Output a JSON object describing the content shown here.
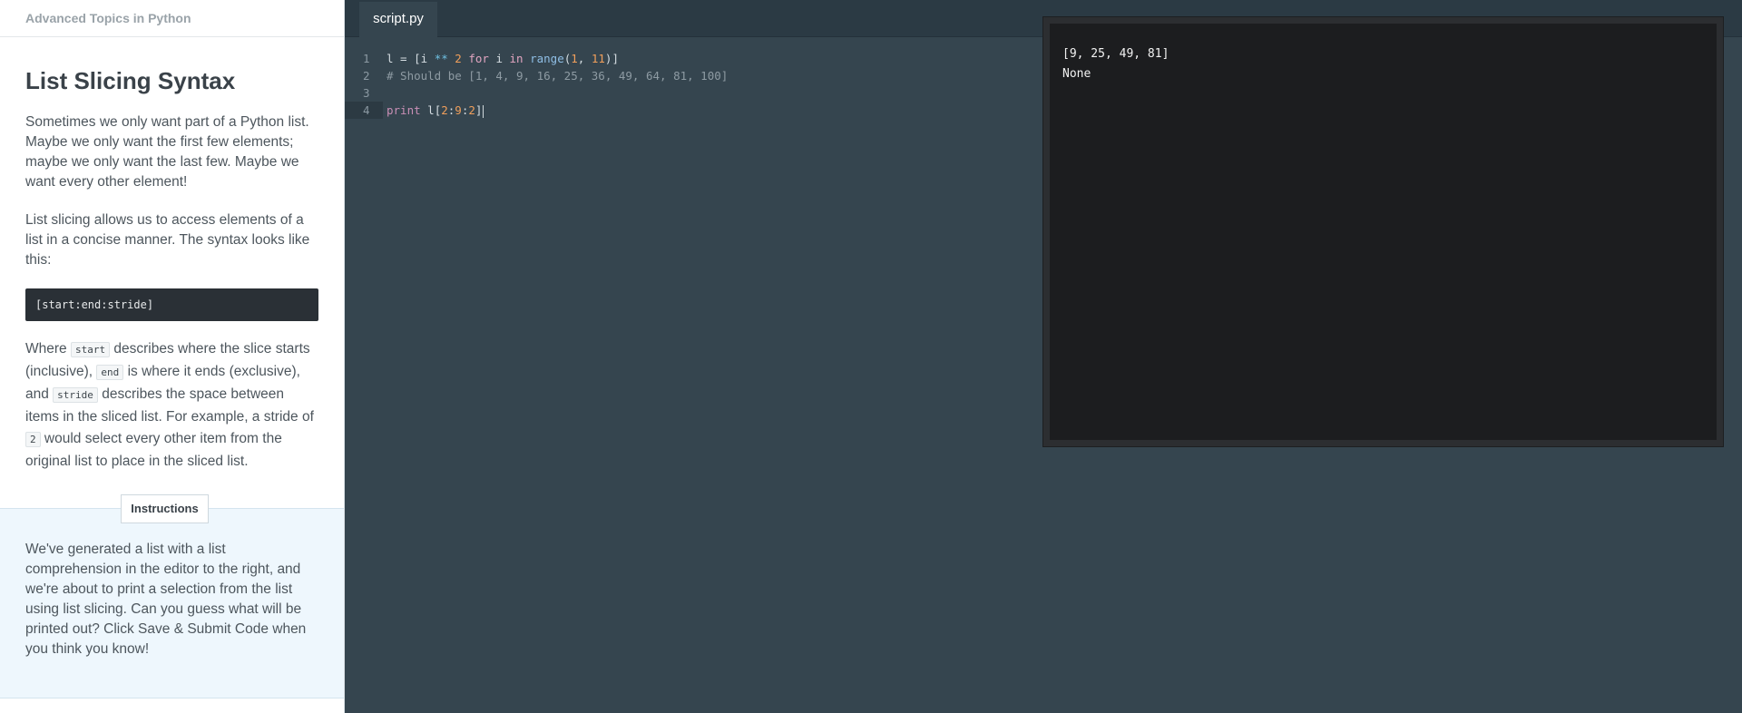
{
  "lesson": {
    "course_title": "Advanced Topics in Python",
    "title": "List Slicing Syntax",
    "paragraph_1": "Sometimes we only want part of a Python list. Maybe we only want the first few elements; maybe we only want the last few. Maybe we want every other element!",
    "paragraph_2": "List slicing allows us to access elements of a list in a concise manner. The syntax looks like this:",
    "syntax_example": "[start:end:stride]",
    "paragraph_3": {
      "t1": "Where ",
      "code1": "start",
      "t2": " describes where the slice starts (inclusive), ",
      "code2": "end",
      "t3": " is where it ends (exclusive), and ",
      "code3": "stride",
      "t4": " describes the space between items in the sliced list. For example, a stride of ",
      "code4": "2",
      "t5": " would select every other item from the original list to place in the sliced list."
    }
  },
  "instructions": {
    "tab_label": "Instructions",
    "text": "We've generated a list with a list comprehension in the editor to the right, and we're about to print a selection from the list using list slicing. Can you guess what will be printed out? Click Save & Submit Code when you think you know!"
  },
  "editor": {
    "file_tab": "script.py",
    "lines": [
      {
        "number": "1",
        "tokens": {
          "a": "l = [i ",
          "b": "**",
          "c": " ",
          "d": "2",
          "e": " ",
          "f": "for",
          "g": " i ",
          "h": "in",
          "i": " ",
          "j": "range",
          "k": "(",
          "l": "1",
          "m": ", ",
          "n": "11",
          "o": ")]"
        }
      },
      {
        "number": "2",
        "comment": "# Should be [1, 4, 9, 16, 25, 36, 49, 64, 81, 100]"
      },
      {
        "number": "3"
      },
      {
        "number": "4",
        "tokens": {
          "a": "print",
          "b": " l[",
          "c": "2",
          "d": ":",
          "e": "9",
          "f": ":",
          "g": "2",
          "h": "]"
        }
      }
    ]
  },
  "console": {
    "lines": [
      "[9, 25, 49, 81]",
      "None"
    ]
  }
}
